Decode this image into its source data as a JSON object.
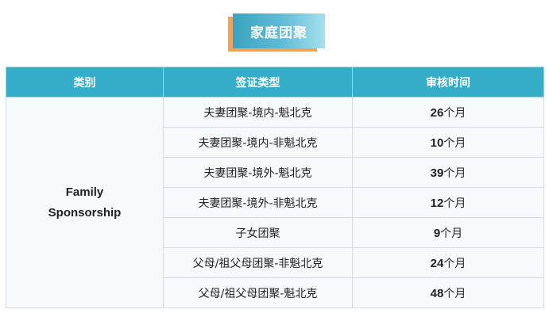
{
  "banner": {
    "title": "家庭团聚"
  },
  "table": {
    "headers": [
      "类别",
      "签证类型",
      "审核时间"
    ],
    "category_line1": "Family",
    "category_line2": "Sponsorship",
    "rows": [
      {
        "visa_type": "夫妻团聚-境内-魁北克",
        "num": "26",
        "unit": "个月"
      },
      {
        "visa_type": "夫妻团聚-境内-非魁北克",
        "num": "10",
        "unit": "个月"
      },
      {
        "visa_type": "夫妻团聚-境外-魁北克",
        "num": "39",
        "unit": "个月"
      },
      {
        "visa_type": "夫妻团聚-境外-非魁北克",
        "num": "12",
        "unit": "个月"
      },
      {
        "visa_type": "子女团聚",
        "num": "9",
        "unit": "个月"
      },
      {
        "visa_type": "父母/祖父母团聚-非魁北克",
        "num": "24",
        "unit": "个月"
      },
      {
        "visa_type": "父母/祖父母团聚-魁北克",
        "num": "48",
        "unit": "个月"
      }
    ]
  },
  "colors": {
    "header_bg": "#35adc9",
    "banner_gradient_start": "#3aa3bf",
    "banner_gradient_end": "#a6e0ee",
    "banner_shadow": "#f4a259",
    "cell_bg": "#f7fafd"
  }
}
